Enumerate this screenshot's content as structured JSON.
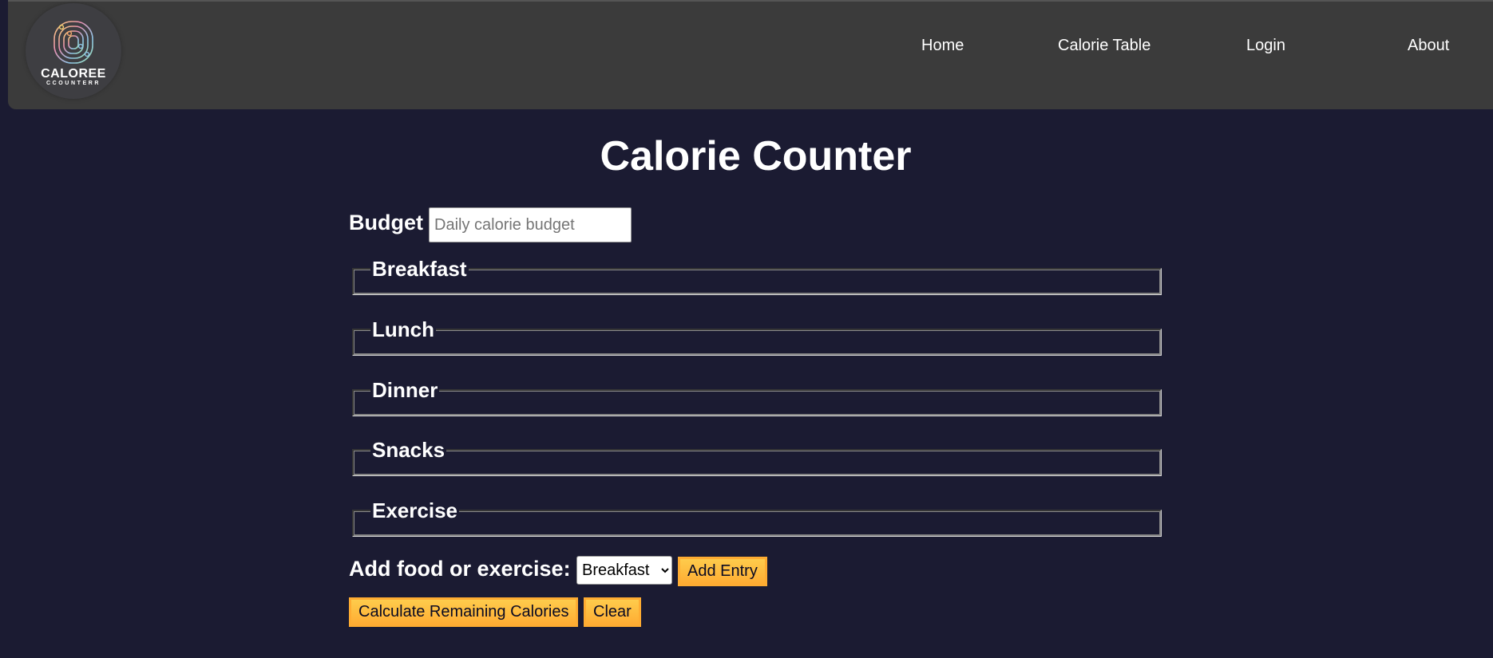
{
  "header": {
    "logo_text": "CALOREE",
    "logo_subtext": "CCOUNTERR",
    "nav": [
      {
        "label": "Home"
      },
      {
        "label": "Calorie Table"
      },
      {
        "label": "Login"
      },
      {
        "label": "About"
      }
    ]
  },
  "main": {
    "title": "Calorie Counter",
    "budget_label": "Budget",
    "budget_placeholder": "Daily calorie budget",
    "budget_value": "",
    "sections": [
      {
        "legend": "Breakfast"
      },
      {
        "legend": "Lunch"
      },
      {
        "legend": "Dinner"
      },
      {
        "legend": "Snacks"
      },
      {
        "legend": "Exercise"
      }
    ],
    "add_label": "Add food or exercise:",
    "entry_select": {
      "selected": "Breakfast"
    },
    "add_entry_button": "Add Entry",
    "calculate_button": "Calculate Remaining Calories",
    "clear_button": "Clear"
  },
  "colors": {
    "page_background": "#1b1b32",
    "header_background": "#3b3b3b",
    "button_yellow": "#feac32",
    "text": "#ffffff"
  }
}
